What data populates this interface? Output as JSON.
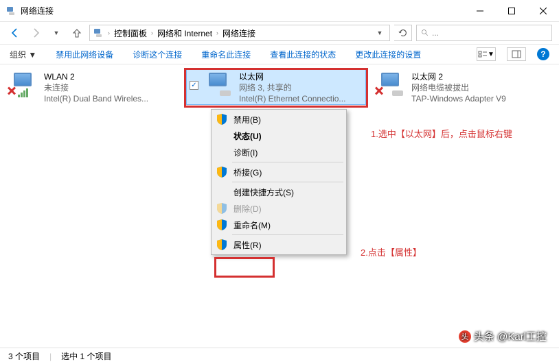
{
  "window": {
    "title": "网络连接"
  },
  "caption": {
    "min": "—",
    "max": "☐",
    "close": "✕"
  },
  "breadcrumb": {
    "level1": "控制面板",
    "level2": "网络和 Internet",
    "level3": "网络连接",
    "sep": "›"
  },
  "search": {
    "placeholder": "..."
  },
  "toolbar": {
    "organize": "组织 ▼",
    "disable": "禁用此网络设备",
    "diagnose": "诊断这个连接",
    "rename": "重命名此连接",
    "status": "查看此连接的状态",
    "settings": "更改此连接的设置"
  },
  "items": [
    {
      "name": "WLAN 2",
      "status": "未连接",
      "device": "Intel(R) Dual Band Wireles..."
    },
    {
      "name": "以太网",
      "status": "网络 3, 共享的",
      "device": "Intel(R) Ethernet Connectio..."
    },
    {
      "name": "以太网 2",
      "status": "网络电缆被拔出",
      "device": "TAP-Windows Adapter V9"
    }
  ],
  "checkbox": "✓",
  "context_menu": {
    "disable": "禁用(B)",
    "state": "状态(U)",
    "diagnose": "诊断(I)",
    "bridge": "桥接(G)",
    "shortcut": "创建快捷方式(S)",
    "delete": "删除(D)",
    "rename": "重命名(M)",
    "properties": "属性(R)"
  },
  "annotations": {
    "step1": "1.选中【以太网】后，点击鼠标右键",
    "step2": "2.点击【属性】"
  },
  "watermark": "头条 @Karl工控",
  "statusbar": {
    "count": "3 个项目",
    "selected": "选中 1 个项目"
  }
}
